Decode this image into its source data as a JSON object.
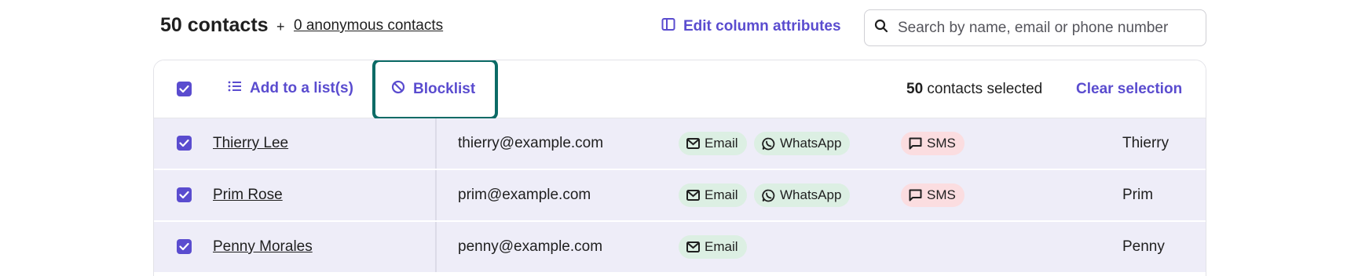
{
  "header": {
    "contacts_count": "50 contacts",
    "plus": "+",
    "anonymous_link": "0 anonymous contacts",
    "edit_columns_label": "Edit column attributes",
    "search_placeholder": "Search by name, email or phone number"
  },
  "action_bar": {
    "add_to_list_label": "Add to a list(s)",
    "blocklist_label": "Blocklist",
    "selected_count": "50",
    "selected_suffix": " contacts selected",
    "clear_selection_label": "Clear selection"
  },
  "rows": [
    {
      "name": "Thierry Lee",
      "email": "thierry@example.com",
      "email_chip": "Email",
      "whatsapp_chip": "WhatsApp",
      "sms_chip": "SMS",
      "first_name": "Thierry"
    },
    {
      "name": "Prim Rose",
      "email": "prim@example.com",
      "email_chip": "Email",
      "whatsapp_chip": "WhatsApp",
      "sms_chip": "SMS",
      "first_name": "Prim"
    },
    {
      "name": "Penny Morales",
      "email": "penny@example.com",
      "email_chip": "Email",
      "first_name": "Penny"
    }
  ],
  "colors": {
    "accent": "#5a4ccf",
    "highlight_outline": "#0c6b66",
    "selected_row_bg": "#eeedf8",
    "channel_green_bg": "#dcefe3",
    "channel_red_bg": "#fbdde0"
  },
  "icons": {
    "edit_columns": "columns-icon",
    "search": "search-icon",
    "add_to_list": "list-icon",
    "blocklist": "block-icon",
    "email": "envelope-icon",
    "whatsapp": "whatsapp-icon",
    "sms": "chat-bubble-icon"
  }
}
